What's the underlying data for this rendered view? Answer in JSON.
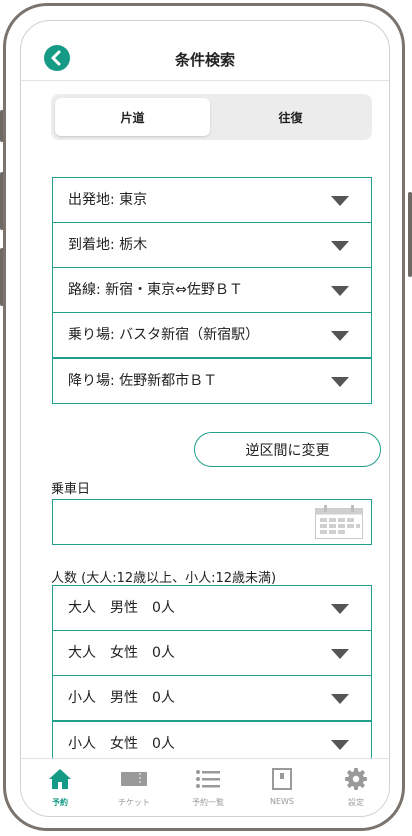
{
  "header": {
    "title": "条件検索"
  },
  "trip_type": {
    "one_way": "片道",
    "round_trip": "往復",
    "selected": "片道"
  },
  "route_fields": [
    {
      "label": "出発地: 東京"
    },
    {
      "label": "到着地: 栃木"
    },
    {
      "label": "路線: 新宿・東京⇔佐野ＢＴ"
    },
    {
      "label": "乗り場: バスタ新宿（新宿駅）"
    },
    {
      "label": "降り場: 佐野新都市ＢＴ"
    }
  ],
  "reverse_button": "逆区間に変更",
  "date": {
    "label": "乗車日",
    "value": ""
  },
  "passengers": {
    "label": "人数 (大人:12歳以上、小人:12歳未満)",
    "rows": [
      {
        "label": "大人　男性　0人"
      },
      {
        "label": "大人　女性　0人"
      },
      {
        "label": "小人　男性　0人"
      },
      {
        "label": "小人　女性　0人"
      }
    ]
  },
  "tabbar": [
    {
      "label": "予約",
      "icon": "home-icon",
      "active": true
    },
    {
      "label": "チケット",
      "icon": "ticket-icon",
      "active": false
    },
    {
      "label": "予約一覧",
      "icon": "list-icon",
      "active": false
    },
    {
      "label": "NEWS",
      "icon": "news-icon",
      "active": false
    },
    {
      "label": "設定",
      "icon": "gear-icon",
      "active": false
    }
  ],
  "colors": {
    "accent": "#159a86",
    "border": "#20a08c"
  }
}
